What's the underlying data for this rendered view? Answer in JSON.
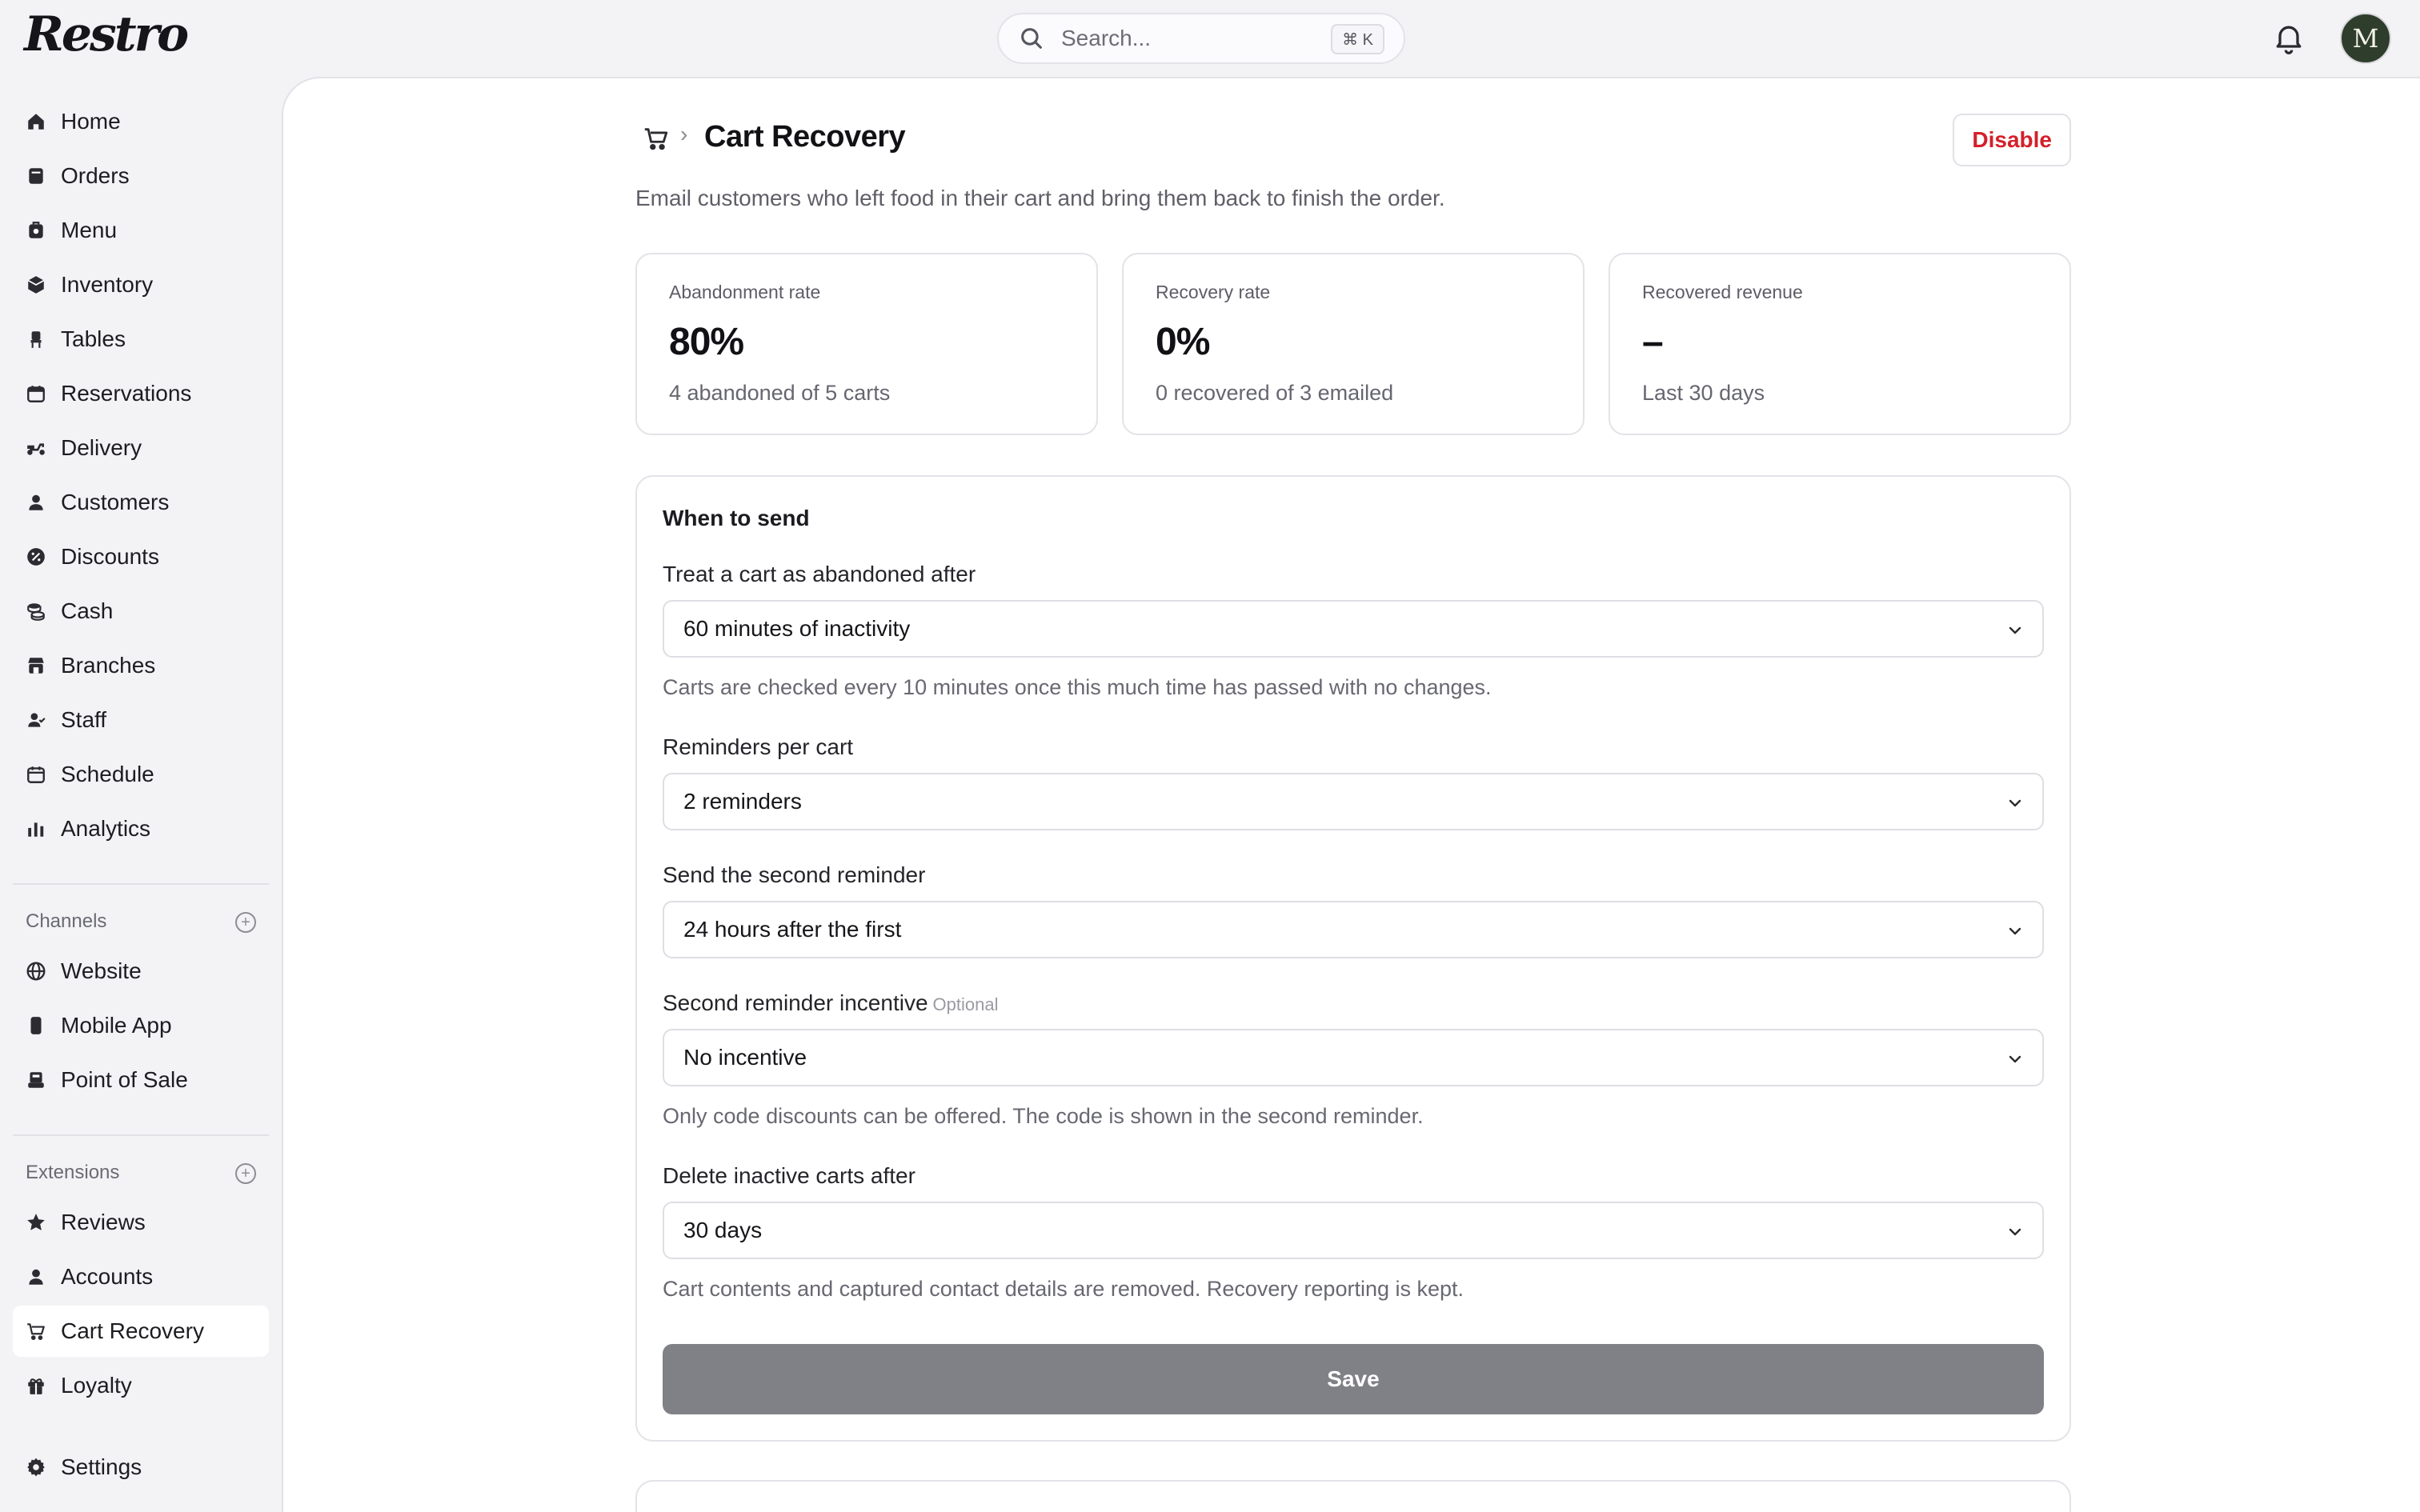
{
  "app": {
    "logo": "Restro"
  },
  "search": {
    "placeholder": "Search...",
    "shortcut": "⌘ K"
  },
  "user": {
    "avatar_initial": "M"
  },
  "sidebar": {
    "items": [
      {
        "label": "Home",
        "icon": "home-icon"
      },
      {
        "label": "Orders",
        "icon": "orders-icon"
      },
      {
        "label": "Menu",
        "icon": "menu-icon"
      },
      {
        "label": "Inventory",
        "icon": "inventory-icon"
      },
      {
        "label": "Tables",
        "icon": "tables-icon"
      },
      {
        "label": "Reservations",
        "icon": "calendar-icon"
      },
      {
        "label": "Delivery",
        "icon": "scooter-icon"
      },
      {
        "label": "Customers",
        "icon": "person-icon"
      },
      {
        "label": "Discounts",
        "icon": "discount-icon"
      },
      {
        "label": "Cash",
        "icon": "coins-icon"
      },
      {
        "label": "Branches",
        "icon": "store-icon"
      },
      {
        "label": "Staff",
        "icon": "staff-icon"
      },
      {
        "label": "Schedule",
        "icon": "schedule-icon"
      },
      {
        "label": "Analytics",
        "icon": "chart-icon"
      }
    ],
    "channels_label": "Channels",
    "channels": [
      {
        "label": "Website",
        "icon": "globe-icon"
      },
      {
        "label": "Mobile App",
        "icon": "phone-icon"
      },
      {
        "label": "Point of Sale",
        "icon": "pos-icon"
      }
    ],
    "extensions_label": "Extensions",
    "extensions": [
      {
        "label": "Reviews",
        "icon": "star-icon"
      },
      {
        "label": "Accounts",
        "icon": "person-icon"
      },
      {
        "label": "Cart Recovery",
        "icon": "cart-icon",
        "active": true
      },
      {
        "label": "Loyalty",
        "icon": "gift-icon"
      }
    ],
    "settings": {
      "label": "Settings",
      "icon": "gear-icon"
    }
  },
  "page": {
    "breadcrumb_sep": "›",
    "title": "Cart Recovery",
    "disable_label": "Disable",
    "subtitle": "Email customers who left food in their cart and bring them back to finish the order."
  },
  "stats": [
    {
      "label": "Abandonment rate",
      "value": "80%",
      "sub": "4 abandoned of 5 carts"
    },
    {
      "label": "Recovery rate",
      "value": "0%",
      "sub": "0 recovered of 3 emailed"
    },
    {
      "label": "Recovered revenue",
      "value": "–",
      "sub": "Last 30 days"
    }
  ],
  "settings_card": {
    "title": "When to send",
    "abandoned_after": {
      "label": "Treat a cart as abandoned after",
      "value": "60 minutes of inactivity",
      "hint": "Carts are checked every 10 minutes once this much time has passed with no changes."
    },
    "reminders": {
      "label": "Reminders per cart",
      "value": "2 reminders"
    },
    "second_reminder": {
      "label": "Send the second reminder",
      "value": "24 hours after the first"
    },
    "incentive": {
      "label": "Second reminder incentive",
      "optional": "Optional",
      "value": "No incentive",
      "hint": "Only code discounts can be offered. The code is shown in the second reminder."
    },
    "delete_after": {
      "label": "Delete inactive carts after",
      "value": "30 days",
      "hint": "Cart contents and captured contact details are removed. Recovery reporting is kept."
    },
    "save_label": "Save"
  },
  "colors": {
    "accent_danger": "#d3202a",
    "save_disabled": "#808087",
    "active_nav_bg": "#ffffff"
  }
}
